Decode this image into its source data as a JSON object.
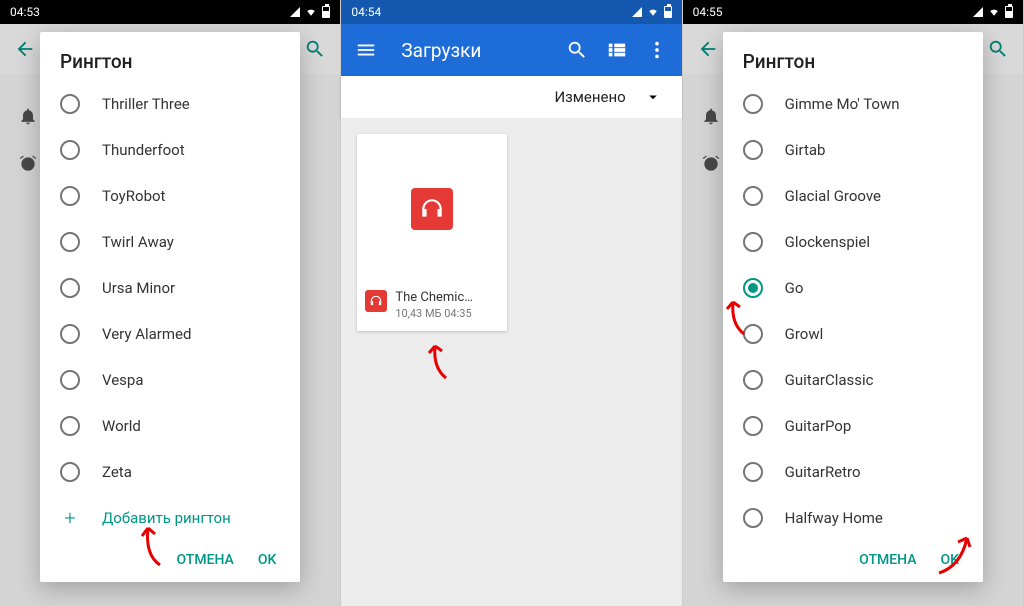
{
  "panel1": {
    "time": "04:53",
    "dialog_title": "Рингтон",
    "items": [
      {
        "label": "Thriller Three",
        "checked": false
      },
      {
        "label": "Thunderfoot",
        "checked": false
      },
      {
        "label": "ToyRobot",
        "checked": false
      },
      {
        "label": "Twirl Away",
        "checked": false
      },
      {
        "label": "Ursa Minor",
        "checked": false
      },
      {
        "label": "Very Alarmed",
        "checked": false
      },
      {
        "label": "Vespa",
        "checked": false
      },
      {
        "label": "World",
        "checked": false
      },
      {
        "label": "Zeta",
        "checked": false
      }
    ],
    "add_label": "Добавить рингтон",
    "cancel": "ОТМЕНА",
    "ok": "OK"
  },
  "panel2": {
    "time": "04:54",
    "appbar_title": "Загрузки",
    "sort_label": "Изменено",
    "file": {
      "name": "The Chemic…",
      "size": "10,43 МБ",
      "mod_time": "04:35"
    }
  },
  "panel3": {
    "time": "04:55",
    "dialog_title": "Рингтон",
    "items": [
      {
        "label": "Gimme Mo' Town",
        "checked": false
      },
      {
        "label": "Girtab",
        "checked": false
      },
      {
        "label": "Glacial Groove",
        "checked": false
      },
      {
        "label": "Glockenspiel",
        "checked": false
      },
      {
        "label": "Go",
        "checked": true
      },
      {
        "label": "Growl",
        "checked": false
      },
      {
        "label": "GuitarClassic",
        "checked": false
      },
      {
        "label": "GuitarPop",
        "checked": false
      },
      {
        "label": "GuitarRetro",
        "checked": false
      },
      {
        "label": "Halfway Home",
        "checked": false
      }
    ],
    "cancel": "ОТМЕНА",
    "ok": "OK"
  }
}
